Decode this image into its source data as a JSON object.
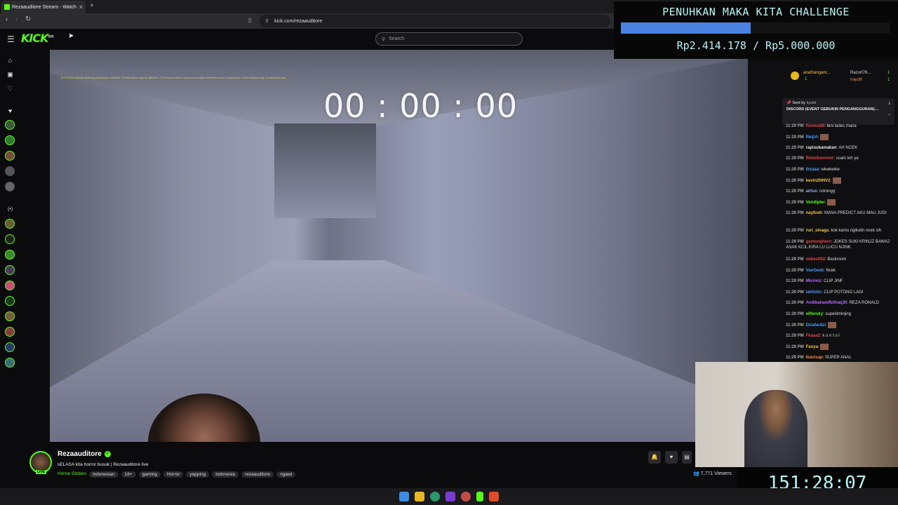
{
  "browser": {
    "tab_title": "Rezaauditore Stream - Watch",
    "new_tab": "+",
    "url": "kick.com/rezaauditore"
  },
  "header": {
    "logo": "KICK",
    "logo_badge": "BETA",
    "search_placeholder": "Search"
  },
  "video": {
    "warning": "[FCM] Non-Mantle Marking risk/Queue overflow. Performance may be affected. This occurs when many non-mantle members cover a large area of the shadow map. (5 seconds ago)",
    "timer": "00 : 00 : 00"
  },
  "challenge": {
    "title": "PENUHKAN MAKA KITA CHALLENGE",
    "amount": "Rp2.414.178 / Rp5.000.000",
    "progress": 0.4828,
    "bar_color": "#4a82e2"
  },
  "chat": {
    "gifters": [
      {
        "name": "anathangant...",
        "count": "1"
      },
      {
        "name": "Razort76...",
        "count": "1"
      },
      {
        "name": "nayolll",
        "count": "1"
      }
    ],
    "pinned_sender": "Sent by",
    "pinned_user": "kyuiki",
    "pinned_text": "DISCORD (EVENT GEBUKIN PENGANGGURAN):...",
    "messages": [
      {
        "time": "11:29 PM",
        "user": "Ranma89",
        "text": "bini lades mana",
        "color": "#e0454a"
      },
      {
        "time": "11:29 PM",
        "user": "ReijiA",
        "text": "",
        "color": "#4a9bff"
      },
      {
        "time": "11:29 PM",
        "user": "rapisukamakan",
        "text": "AH NCEK",
        "color": "#e8e8e8"
      },
      {
        "time": "11:29 PM",
        "user": "Rebelbemmer",
        "text": "scam loh ya",
        "color": "#e0454a"
      },
      {
        "time": "11:29 PM",
        "user": "Ihzaaa",
        "text": "wkwkwkw",
        "color": "#4a9bff"
      },
      {
        "time": "11:29 PM",
        "user": "kevin2NNV2",
        "text": "",
        "color": "#f5c542"
      },
      {
        "time": "11:29 PM",
        "user": "airlux",
        "text": "ndrongg",
        "color": "#8fb7ff"
      },
      {
        "time": "11:29 PM",
        "user": "Vendipler",
        "text": "",
        "color": "#53fc18"
      },
      {
        "time": "11:29 PM",
        "user": "nayfosh",
        "text": "MANA PREDICT AKU MAU JUDI",
        "color": "#f5c542"
      },
      {
        "time": "11:29 PM",
        "user": "ruri_sinaga",
        "text": "kok kamu ngikutin ncek sih",
        "color": "#f5c542"
      },
      {
        "time": "11:29 PM",
        "user": "gemenghero",
        "text": "JOKES SUKI KRINJZ BAWA2 ANAK KCIL KIRA LU LUCU NJINK",
        "color": "#e0454a"
      },
      {
        "time": "11:29 PM",
        "user": "mikeo002",
        "text": "Backroom",
        "color": "#e0454a"
      },
      {
        "time": "11:29 PM",
        "user": "VanGeek",
        "text": "Ncek",
        "color": "#4a9bff"
      },
      {
        "time": "11:29 PM",
        "user": "Micinnz",
        "text": "CLIP JINF",
        "color": "#b86bff"
      },
      {
        "time": "11:29 PM",
        "user": "iahlistic",
        "text": "CLIP POTONG LAGI",
        "color": "#4a9bff"
      },
      {
        "time": "11:29 PM",
        "user": "Andikahanifbilhaq30",
        "text": "REZA RONALD",
        "color": "#b86bff"
      },
      {
        "time": "11:29 PM",
        "user": "ellfersky",
        "text": "superliminjing",
        "color": "#53fc18"
      },
      {
        "time": "11:29 PM",
        "user": "Dziafardzi",
        "text": "",
        "color": "#4a9bff"
      },
      {
        "time": "11:29 PM",
        "user": "Fkaaa2",
        "text": "k o n t o l",
        "color": "#e0454a"
      },
      {
        "time": "11:29 PM",
        "user": "Faoya",
        "text": "",
        "color": "#f5c542"
      },
      {
        "time": "11:29 PM",
        "user": "Ikanisap",
        "text": "SUPER ANAL",
        "color": "#f58a42"
      }
    ]
  },
  "stream": {
    "streamer": "Rezaauditore",
    "live": "LIVE",
    "title": "sELASA kita horror busuk | Rezaauditore live",
    "category": "Horror Globes",
    "tags": [
      "Indonesian",
      "18+",
      "gaming",
      "Horror",
      "yapping",
      "indonesia",
      "rezaauditore",
      "ngawi"
    ],
    "viewers": "7,771 Viewers"
  },
  "uptime": "151:28:07",
  "colors": {
    "accent": "#53fc18",
    "overlay_text": "#b8f6f6"
  }
}
